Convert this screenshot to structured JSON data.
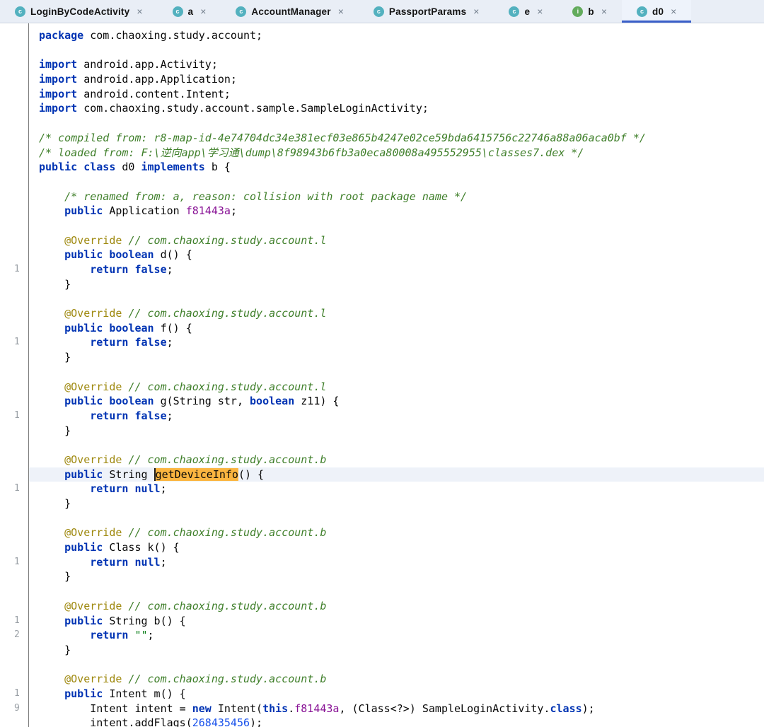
{
  "colors": {
    "keyword": "#0033b3",
    "comment": "#3f7f2a",
    "annotation": "#9e880d",
    "string": "#067d17",
    "number": "#1750eb",
    "field": "#871094",
    "word_highlight": "#fbb540",
    "active_tab_underline": "#3a5fc8",
    "tabbar_background": "#e9eef6"
  },
  "tab_close_glyph": "×",
  "tabs": [
    {
      "label": "LoginByCodeActivity",
      "icon": "class",
      "letter": "c",
      "active": false
    },
    {
      "label": "a",
      "icon": "class",
      "letter": "c",
      "active": false
    },
    {
      "label": "AccountManager",
      "icon": "class",
      "letter": "c",
      "active": false
    },
    {
      "label": "PassportParams",
      "icon": "class",
      "letter": "c",
      "active": false
    },
    {
      "label": "e",
      "icon": "class",
      "letter": "c",
      "active": false
    },
    {
      "label": "b",
      "icon": "interface",
      "letter": "i",
      "active": false
    },
    {
      "label": "d0",
      "icon": "class",
      "letter": "c",
      "active": true
    }
  ],
  "editor": {
    "highlighted_word": "getDeviceInfo",
    "lines": [
      {
        "g": "",
        "tokens": [
          {
            "c": "kw",
            "t": "package"
          },
          {
            "t": " com.chaoxing.study.account;"
          }
        ]
      },
      {
        "g": "",
        "tokens": []
      },
      {
        "g": "",
        "tokens": [
          {
            "c": "kw",
            "t": "import"
          },
          {
            "t": " android.app.Activity;"
          }
        ]
      },
      {
        "g": "",
        "tokens": [
          {
            "c": "kw",
            "t": "import"
          },
          {
            "t": " android.app.Application;"
          }
        ]
      },
      {
        "g": "",
        "tokens": [
          {
            "c": "kw",
            "t": "import"
          },
          {
            "t": " android.content.Intent;"
          }
        ]
      },
      {
        "g": "",
        "tokens": [
          {
            "c": "kw",
            "t": "import"
          },
          {
            "t": " com.chaoxing.study.account.sample.SampleLoginActivity;"
          }
        ]
      },
      {
        "g": "",
        "tokens": []
      },
      {
        "g": "",
        "tokens": [
          {
            "c": "cm",
            "t": "/* compiled from: r8-map-id-4e74704dc34e381ecf03e865b4247e02ce59bda6415756c22746a88a06aca0bf */"
          }
        ]
      },
      {
        "g": "",
        "tokens": [
          {
            "c": "cm",
            "t": "/* loaded from: F:\\逆向app\\学习通\\dump\\8f98943b6fb3a0eca80008a495552955\\classes7.dex */"
          }
        ]
      },
      {
        "g": "",
        "tokens": [
          {
            "c": "kw",
            "t": "public class"
          },
          {
            "t": " d0 "
          },
          {
            "c": "kw",
            "t": "implements"
          },
          {
            "t": " b {"
          }
        ]
      },
      {
        "g": "",
        "tokens": []
      },
      {
        "g": "",
        "tokens": [
          {
            "c": "cm",
            "t": "    /* renamed from: a, reason: collision with root package name */"
          }
        ]
      },
      {
        "g": "",
        "tokens": [
          {
            "t": "    "
          },
          {
            "c": "kw",
            "t": "public"
          },
          {
            "t": " Application "
          },
          {
            "c": "fld",
            "t": "f81443a"
          },
          {
            "t": ";"
          }
        ]
      },
      {
        "g": "",
        "tokens": []
      },
      {
        "g": "",
        "tokens": [
          {
            "t": "    "
          },
          {
            "c": "an",
            "t": "@Override"
          },
          {
            "t": " "
          },
          {
            "c": "cm",
            "t": "// com.chaoxing.study.account.l"
          }
        ]
      },
      {
        "g": "",
        "tokens": [
          {
            "t": "    "
          },
          {
            "c": "kw",
            "t": "public boolean"
          },
          {
            "t": " d() {"
          }
        ]
      },
      {
        "g": "1",
        "tokens": [
          {
            "t": "        "
          },
          {
            "c": "kw",
            "t": "return false"
          },
          {
            "t": ";"
          }
        ]
      },
      {
        "g": "",
        "tokens": [
          {
            "t": "    }"
          }
        ]
      },
      {
        "g": "",
        "tokens": []
      },
      {
        "g": "",
        "tokens": [
          {
            "t": "    "
          },
          {
            "c": "an",
            "t": "@Override"
          },
          {
            "t": " "
          },
          {
            "c": "cm",
            "t": "// com.chaoxing.study.account.l"
          }
        ]
      },
      {
        "g": "",
        "tokens": [
          {
            "t": "    "
          },
          {
            "c": "kw",
            "t": "public boolean"
          },
          {
            "t": " f() {"
          }
        ]
      },
      {
        "g": "1",
        "tokens": [
          {
            "t": "        "
          },
          {
            "c": "kw",
            "t": "return false"
          },
          {
            "t": ";"
          }
        ]
      },
      {
        "g": "",
        "tokens": [
          {
            "t": "    }"
          }
        ]
      },
      {
        "g": "",
        "tokens": []
      },
      {
        "g": "",
        "tokens": [
          {
            "t": "    "
          },
          {
            "c": "an",
            "t": "@Override"
          },
          {
            "t": " "
          },
          {
            "c": "cm",
            "t": "// com.chaoxing.study.account.l"
          }
        ]
      },
      {
        "g": "",
        "tokens": [
          {
            "t": "    "
          },
          {
            "c": "kw",
            "t": "public boolean"
          },
          {
            "t": " g(String str, "
          },
          {
            "c": "kw",
            "t": "boolean"
          },
          {
            "t": " z11) {"
          }
        ]
      },
      {
        "g": "1",
        "tokens": [
          {
            "t": "        "
          },
          {
            "c": "kw",
            "t": "return false"
          },
          {
            "t": ";"
          }
        ]
      },
      {
        "g": "",
        "tokens": [
          {
            "t": "    }"
          }
        ]
      },
      {
        "g": "",
        "tokens": []
      },
      {
        "g": "",
        "tokens": [
          {
            "t": "    "
          },
          {
            "c": "an",
            "t": "@Override"
          },
          {
            "t": " "
          },
          {
            "c": "cm",
            "t": "// com.chaoxing.study.account.b"
          }
        ]
      },
      {
        "g": "",
        "cur": true,
        "tokens": [
          {
            "t": "    "
          },
          {
            "c": "kw",
            "t": "public"
          },
          {
            "t": " String "
          },
          {
            "c": "hl",
            "t": "getDeviceInfo"
          },
          {
            "t": "() {"
          }
        ]
      },
      {
        "g": "1",
        "tokens": [
          {
            "t": "        "
          },
          {
            "c": "kw",
            "t": "return null"
          },
          {
            "t": ";"
          }
        ]
      },
      {
        "g": "",
        "tokens": [
          {
            "t": "    }"
          }
        ]
      },
      {
        "g": "",
        "tokens": []
      },
      {
        "g": "",
        "tokens": [
          {
            "t": "    "
          },
          {
            "c": "an",
            "t": "@Override"
          },
          {
            "t": " "
          },
          {
            "c": "cm",
            "t": "// com.chaoxing.study.account.b"
          }
        ]
      },
      {
        "g": "",
        "tokens": [
          {
            "t": "    "
          },
          {
            "c": "kw",
            "t": "public"
          },
          {
            "t": " Class k() {"
          }
        ]
      },
      {
        "g": "1",
        "tokens": [
          {
            "t": "        "
          },
          {
            "c": "kw",
            "t": "return null"
          },
          {
            "t": ";"
          }
        ]
      },
      {
        "g": "",
        "tokens": [
          {
            "t": "    }"
          }
        ]
      },
      {
        "g": "",
        "tokens": []
      },
      {
        "g": "",
        "tokens": [
          {
            "t": "    "
          },
          {
            "c": "an",
            "t": "@Override"
          },
          {
            "t": " "
          },
          {
            "c": "cm",
            "t": "// com.chaoxing.study.account.b"
          }
        ]
      },
      {
        "g": "1",
        "tokens": [
          {
            "t": "    "
          },
          {
            "c": "kw",
            "t": "public"
          },
          {
            "t": " String b() {"
          }
        ]
      },
      {
        "g": "2",
        "tokens": [
          {
            "t": "        "
          },
          {
            "c": "kw",
            "t": "return"
          },
          {
            "t": " "
          },
          {
            "c": "str",
            "t": "\"\""
          },
          {
            "t": ";"
          }
        ]
      },
      {
        "g": "",
        "tokens": [
          {
            "t": "    }"
          }
        ]
      },
      {
        "g": "",
        "tokens": []
      },
      {
        "g": "",
        "tokens": [
          {
            "t": "    "
          },
          {
            "c": "an",
            "t": "@Override"
          },
          {
            "t": " "
          },
          {
            "c": "cm",
            "t": "// com.chaoxing.study.account.b"
          }
        ]
      },
      {
        "g": "1",
        "tokens": [
          {
            "t": "    "
          },
          {
            "c": "kw",
            "t": "public"
          },
          {
            "t": " Intent m() {"
          }
        ]
      },
      {
        "g": "9",
        "tokens": [
          {
            "t": "        Intent intent = "
          },
          {
            "c": "kw",
            "t": "new"
          },
          {
            "t": " Intent("
          },
          {
            "c": "kw",
            "t": "this"
          },
          {
            "t": "."
          },
          {
            "c": "fld",
            "t": "f81443a"
          },
          {
            "t": ", (Class<?>) SampleLoginActivity."
          },
          {
            "c": "kw",
            "t": "class"
          },
          {
            "t": ");"
          }
        ]
      },
      {
        "g": "",
        "tokens": [
          {
            "t": "        intent.addFlags("
          },
          {
            "c": "num",
            "t": "268435456"
          },
          {
            "t": ");"
          }
        ]
      }
    ]
  }
}
